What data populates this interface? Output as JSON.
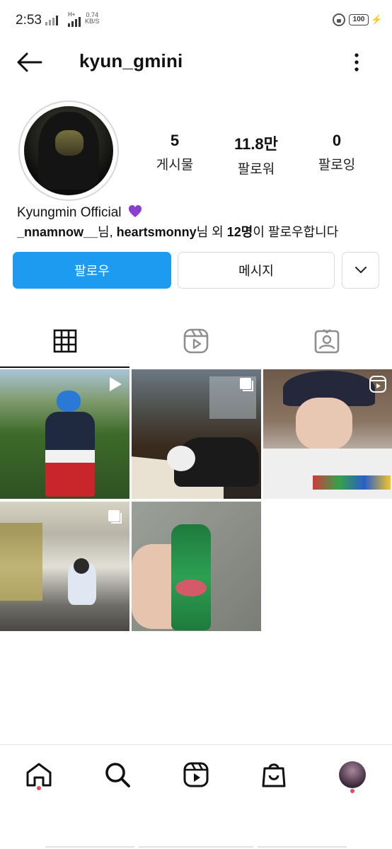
{
  "status_bar": {
    "time": "2:53",
    "network": "H+",
    "speed_value": "0.74",
    "speed_unit": "KB/S",
    "battery": "100"
  },
  "header": {
    "username": "kyun_gmini"
  },
  "profile": {
    "stats": [
      {
        "num": "5",
        "label": "게시물"
      },
      {
        "num": "11.8만",
        "label": "팔로워"
      },
      {
        "num": "0",
        "label": "팔로잉"
      }
    ],
    "bio_name": "Kyungmin Official",
    "followed_by": {
      "user1": "_nnamnow__",
      "sep1": "님, ",
      "user2": "heartsmonny",
      "sep2": "님 외 ",
      "count": "12명",
      "suffix": "이 팔로우합니다"
    }
  },
  "actions": {
    "follow": "팔로우",
    "message": "메시지"
  },
  "tabs": [
    "grid-icon",
    "reels-icon",
    "tagged-icon"
  ],
  "colors": {
    "accent": "#1d9bf0",
    "notification_dot": "#ed4956",
    "verified_heart": "#8a3fd0"
  },
  "nav": [
    "home-icon",
    "search-icon",
    "reels-icon",
    "shop-icon",
    "profile-avatar"
  ]
}
